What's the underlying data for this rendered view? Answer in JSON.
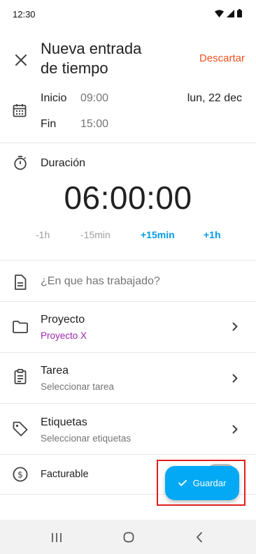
{
  "status_bar": {
    "time": "12:30"
  },
  "header": {
    "title_line1": "Nueva entrada",
    "title_line2": "de tiempo",
    "discard_label": "Descartar"
  },
  "times": {
    "start_label": "Inicio",
    "start_value": "09:00",
    "end_label": "Fin",
    "end_value": "15:00",
    "date": "lun, 22 dec"
  },
  "duration": {
    "label": "Duración",
    "value": "06:00:00",
    "minus_hour": "-1h",
    "minus_15": "-15min",
    "plus_15": "+15min",
    "plus_hour": "+1h"
  },
  "description": {
    "placeholder": "¿En que has trabajado?"
  },
  "project": {
    "title": "Proyecto",
    "value": "Proyecto X"
  },
  "task": {
    "title": "Tarea",
    "subtitle": "Seleccionar tarea"
  },
  "tags": {
    "title": "Etiquetas",
    "subtitle": "Seleccionar etiquetas"
  },
  "billable": {
    "label": "Facturable"
  },
  "fab": {
    "label": "Guardar"
  },
  "colors": {
    "accent": "#03a9f4",
    "discard": "#f4511e",
    "project": "#9c27b0",
    "highlight": "#e11d1d"
  }
}
